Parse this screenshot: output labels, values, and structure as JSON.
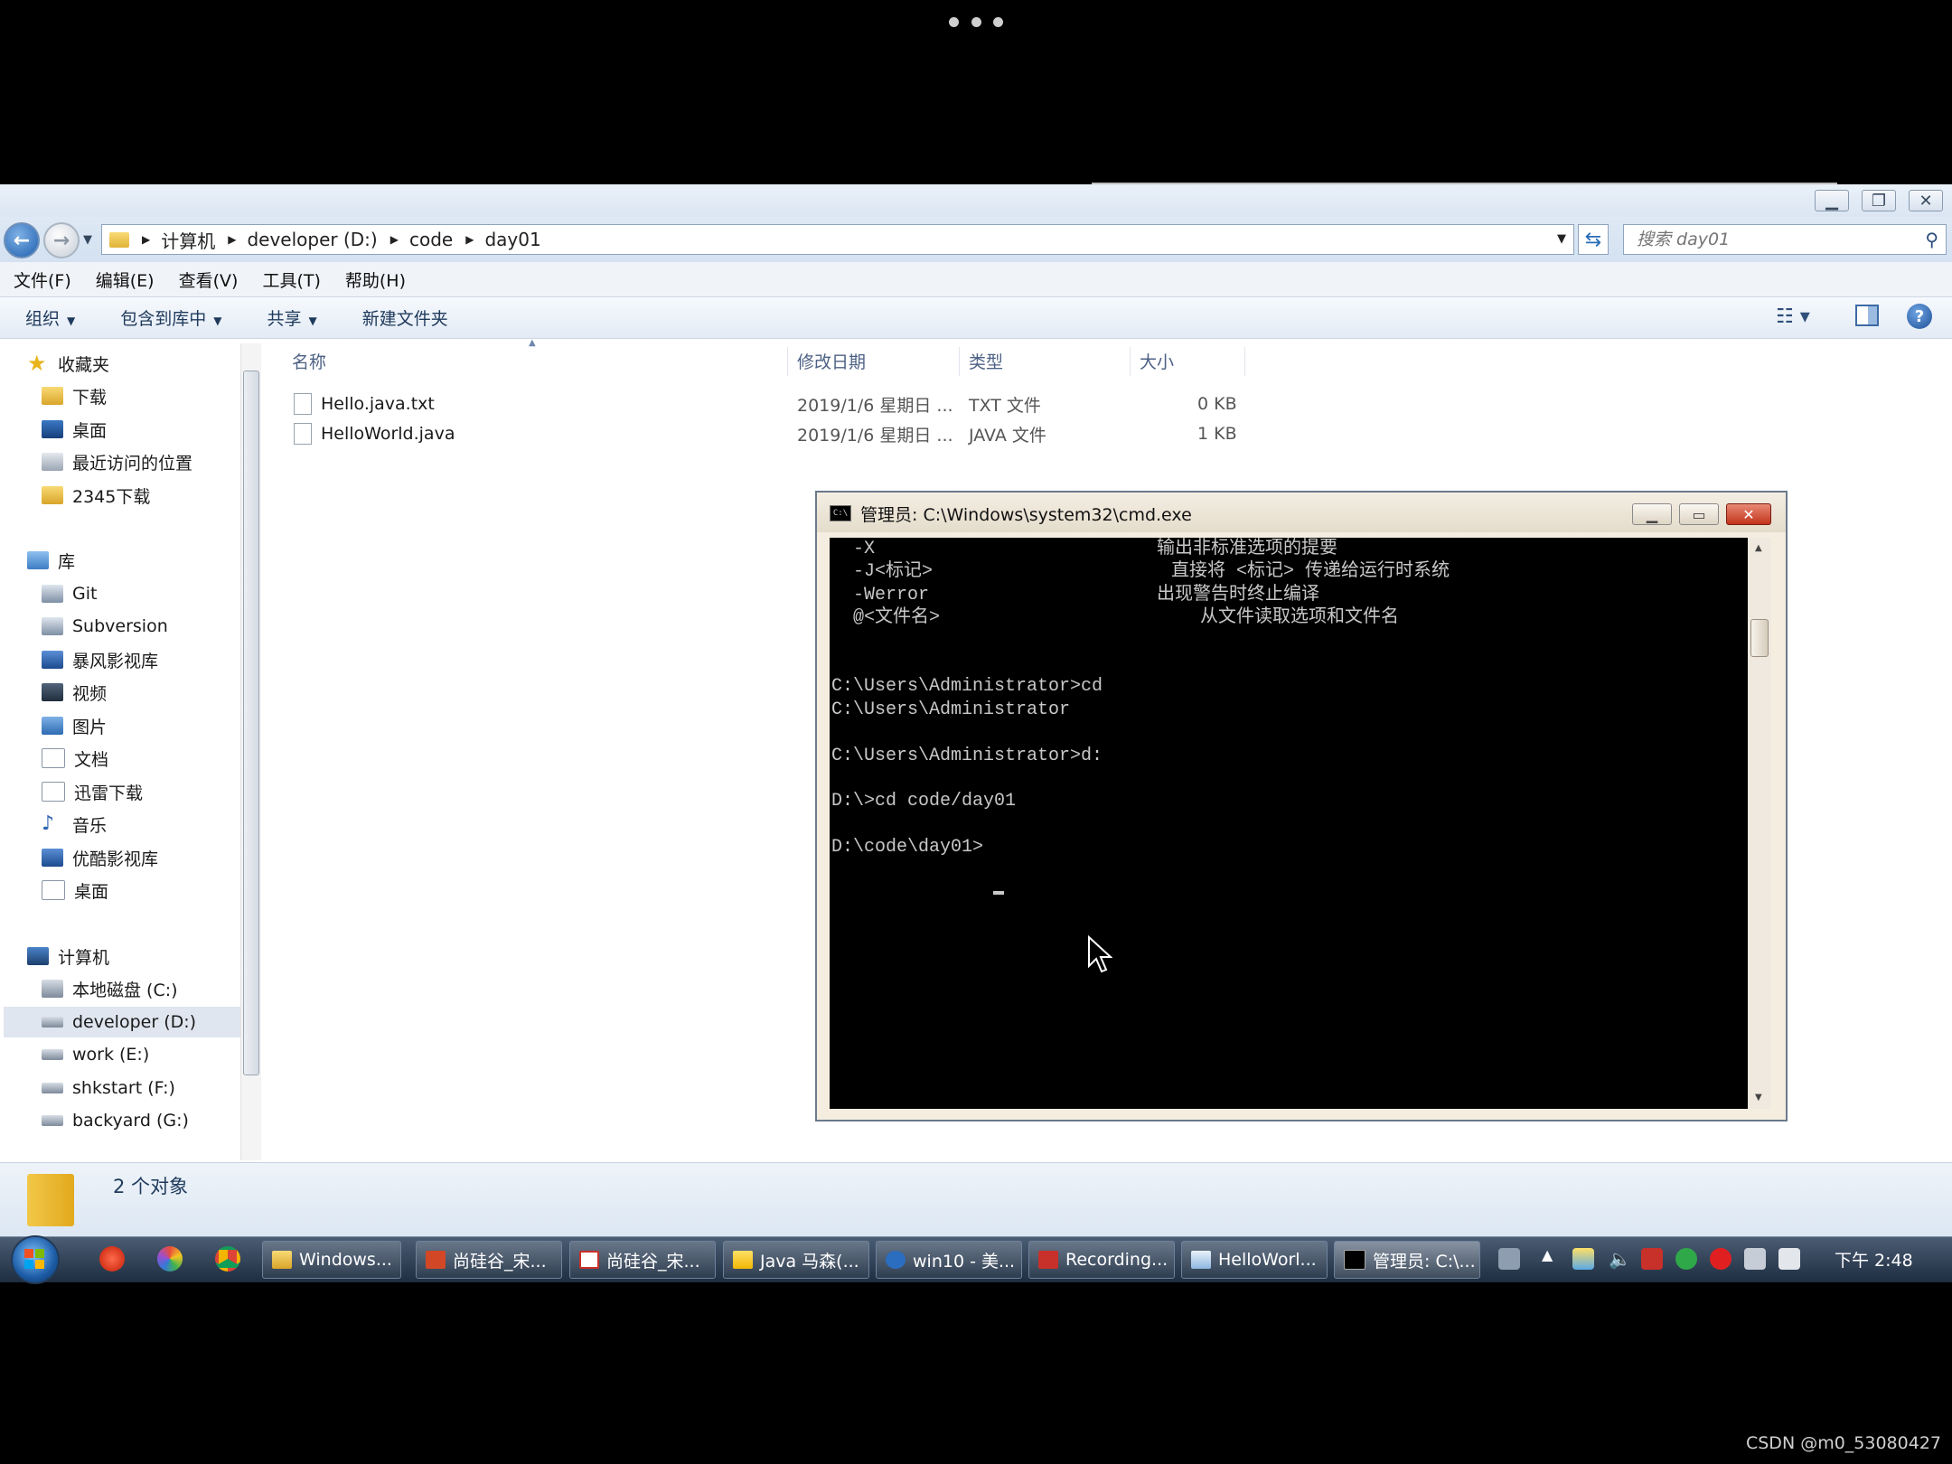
{
  "explorer": {
    "breadcrumbs": [
      "计算机",
      "developer (D:)",
      "code",
      "day01"
    ],
    "search_placeholder": "搜索 day01",
    "menus": [
      "文件(F)",
      "编辑(E)",
      "查看(V)",
      "工具(T)",
      "帮助(H)"
    ],
    "toolbar": [
      "组织",
      "包含到库中",
      "共享",
      "新建文件夹"
    ],
    "sidebar": {
      "favorites": {
        "label": "收藏夹",
        "items": [
          "下载",
          "桌面",
          "最近访问的位置",
          "2345下载"
        ]
      },
      "libraries": {
        "label": "库",
        "items": [
          "Git",
          "Subversion",
          "暴风影视库",
          "视频",
          "图片",
          "文档",
          "迅雷下载",
          "音乐",
          "优酷影视库",
          "桌面"
        ]
      },
      "computer": {
        "label": "计算机",
        "items": [
          "本地磁盘 (C:)",
          "developer (D:)",
          "work (E:)",
          "shkstart (F:)",
          "backyard (G:)"
        ],
        "selected": "developer (D:)"
      }
    },
    "columns": [
      "名称",
      "修改日期",
      "类型",
      "大小"
    ],
    "files": [
      {
        "name": "Hello.java.txt",
        "date": "2019/1/6 星期日 ...",
        "type": "TXT 文件",
        "size": "0 KB"
      },
      {
        "name": "HelloWorld.java",
        "date": "2019/1/6 星期日 ...",
        "type": "JAVA 文件",
        "size": "1 KB"
      }
    ],
    "status": "2 个对象"
  },
  "cmd": {
    "title": "管理员: C:\\Windows\\system32\\cmd.exe",
    "lines": [
      "  -X                          输出非标准选项的提要",
      "  -J<标记>                      直接将 <标记> 传递给运行时系统",
      "  -Werror                     出现警告时终止编译",
      "  @<文件名>                        从文件读取选项和文件名",
      "",
      "",
      "C:\\Users\\Administrator>cd",
      "C:\\Users\\Administrator",
      "",
      "C:\\Users\\Administrator>d:",
      "",
      "D:\\>cd code/day01",
      "",
      "D:\\code\\day01>"
    ]
  },
  "taskbar": {
    "tasks": [
      "Windows...",
      "尚硅谷_宋...",
      "尚硅谷_宋...",
      "Java 马森(...",
      "win10 - 美...",
      "Recording...",
      "HelloWorl...",
      "管理员: C:\\..."
    ],
    "clock": "下午 2:48"
  },
  "watermark": "CSDN @m0_53080427"
}
